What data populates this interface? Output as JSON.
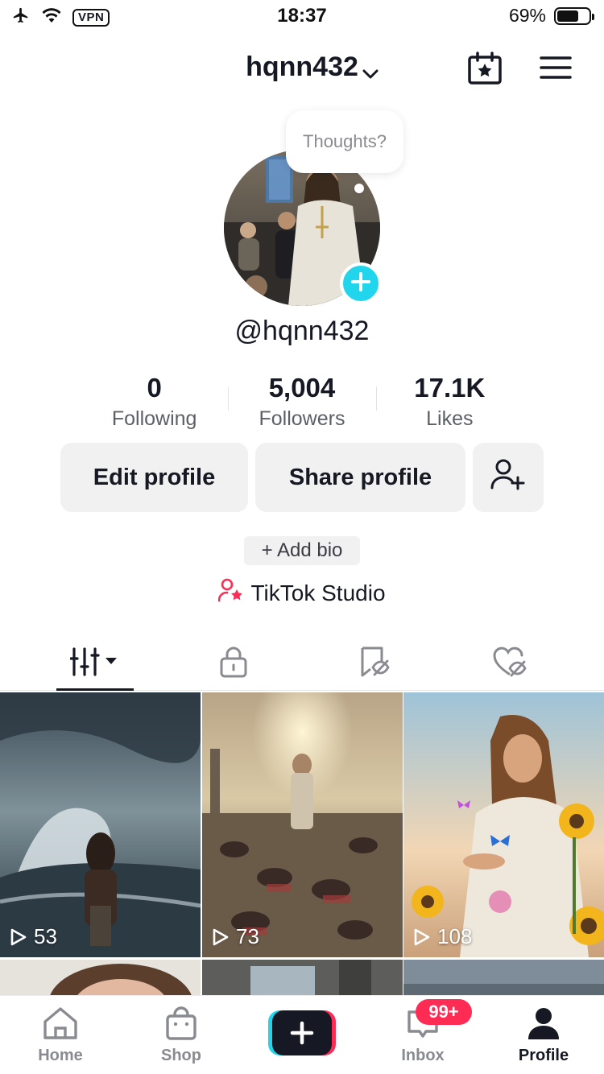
{
  "status_bar": {
    "time": "18:37",
    "vpn": "VPN",
    "battery_text": "69%",
    "battery_level": 0.69
  },
  "top_nav": {
    "username": "hqnn432"
  },
  "profile": {
    "thought_prompt": "Thoughts?",
    "handle": "@hqnn432",
    "stats": [
      {
        "value": "0",
        "label": "Following"
      },
      {
        "value": "5,004",
        "label": "Followers"
      },
      {
        "value": "17.1K",
        "label": "Likes"
      }
    ],
    "edit_label": "Edit profile",
    "share_label": "Share profile",
    "add_bio_label": "+ Add bio",
    "studio_label": "TikTok Studio"
  },
  "videos": [
    {
      "views": "53"
    },
    {
      "views": "73"
    },
    {
      "views": "108"
    }
  ],
  "bottom_nav": {
    "home": "Home",
    "shop": "Shop",
    "inbox": "Inbox",
    "inbox_badge": "99+",
    "profile": "Profile"
  },
  "colors": {
    "accent_cyan": "#20d5ec",
    "accent_red": "#fe2c55",
    "text_primary": "#161823",
    "text_secondary": "#5d5f66",
    "button_bg": "#f1f1f2"
  }
}
